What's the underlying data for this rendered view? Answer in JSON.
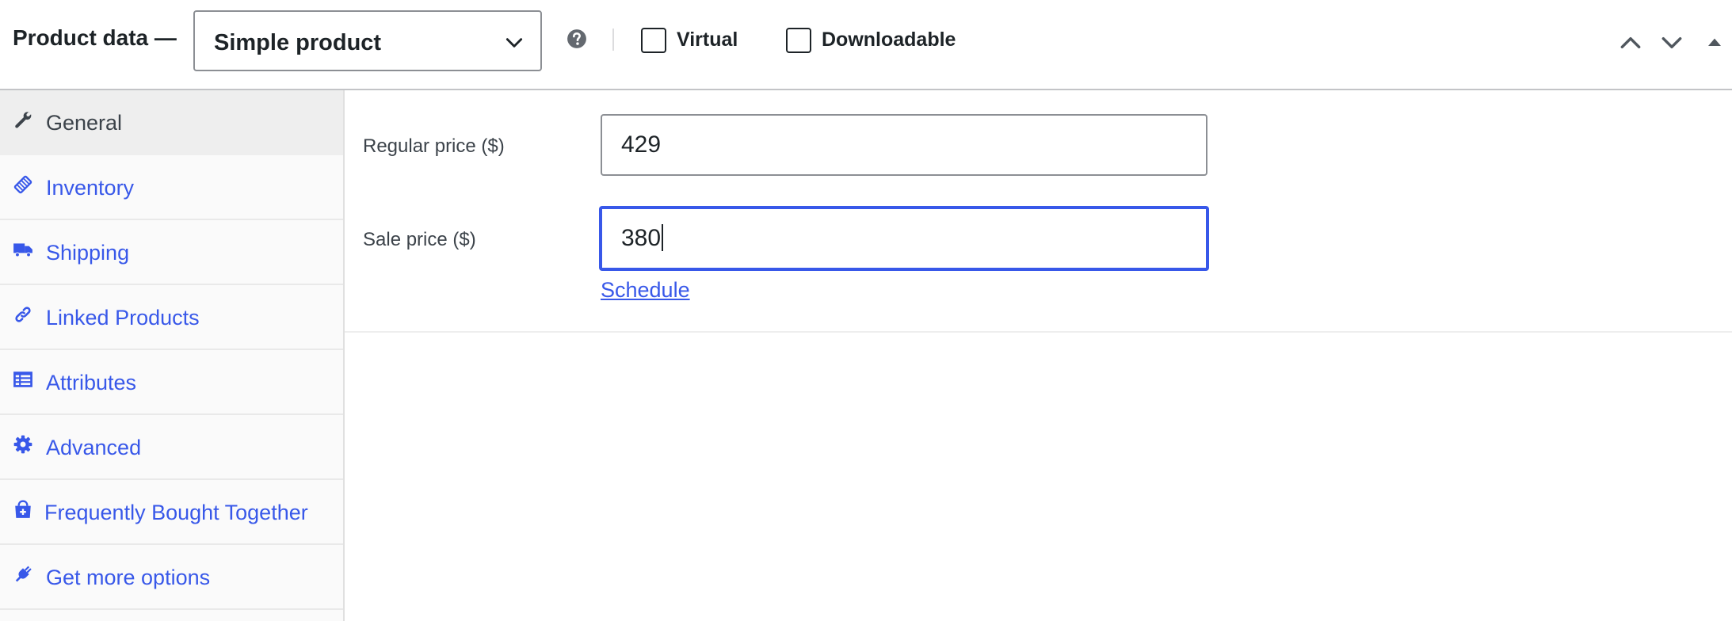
{
  "header": {
    "title": "Product data —",
    "product_type": {
      "selected": "Simple product",
      "icon": "chevron-down-icon"
    },
    "help_icon": "question-circle-icon",
    "checkboxes": [
      {
        "label": "Virtual",
        "checked": false
      },
      {
        "label": "Downloadable",
        "checked": false
      }
    ],
    "controls": [
      "move-up-icon",
      "move-down-icon",
      "toggle-panel-icon"
    ]
  },
  "sidebar": {
    "items": [
      {
        "label": "General",
        "icon": "wrench-icon",
        "active": true
      },
      {
        "label": "Inventory",
        "icon": "tag-icon",
        "active": false
      },
      {
        "label": "Shipping",
        "icon": "truck-icon",
        "active": false
      },
      {
        "label": "Linked Products",
        "icon": "link-icon",
        "active": false
      },
      {
        "label": "Attributes",
        "icon": "list-table-icon",
        "active": false
      },
      {
        "label": "Advanced",
        "icon": "gear-icon",
        "active": false
      },
      {
        "label": "Frequently Bought Together",
        "icon": "shopping-bag-icon",
        "active": false
      },
      {
        "label": "Get more options",
        "icon": "plug-icon",
        "active": false
      }
    ]
  },
  "general": {
    "regular_price": {
      "label": "Regular price ($)",
      "value": "429"
    },
    "sale_price": {
      "label": "Sale price ($)",
      "value": "380",
      "focused": true
    },
    "schedule_link": "Schedule"
  },
  "colors": {
    "accent": "#3858e9",
    "text": "#1d2327",
    "muted_text": "#3c434a",
    "border": "#8c8f94",
    "sidebar_bg": "#fafafa",
    "active_tab_bg": "#eeeeee"
  }
}
